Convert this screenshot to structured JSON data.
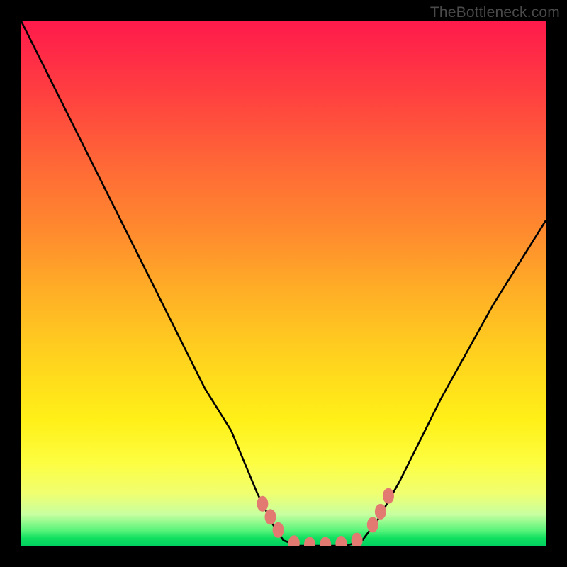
{
  "attribution": "TheBottleneck.com",
  "chart_data": {
    "type": "line",
    "title": "",
    "subtitle": "",
    "xlabel": "",
    "ylabel": "",
    "xlim": [
      0,
      100
    ],
    "ylim": [
      0,
      100
    ],
    "grid": false,
    "legend": false,
    "gradient_colors": {
      "top": "#ff1a4b",
      "upper_mid": "#ff8a2e",
      "mid": "#ffd21e",
      "lower_mid": "#fdfd40",
      "bottom": "#00d060"
    },
    "series": [
      {
        "name": "bottleneck-curve",
        "x": [
          0,
          5,
          10,
          15,
          20,
          25,
          30,
          35,
          40,
          45,
          48,
          50,
          53,
          56,
          59,
          62,
          65,
          68,
          72,
          76,
          80,
          85,
          90,
          95,
          100
        ],
        "y": [
          100,
          90,
          80,
          70,
          60,
          50,
          40,
          30,
          22,
          10,
          4,
          1,
          0,
          0,
          0,
          0,
          1,
          5,
          12,
          20,
          28,
          37,
          46,
          54,
          62
        ]
      }
    ],
    "markers": [
      {
        "name": "left-cluster-1",
        "x": 46,
        "y": 8
      },
      {
        "name": "left-cluster-2",
        "x": 47.5,
        "y": 5.5
      },
      {
        "name": "left-cluster-3",
        "x": 49,
        "y": 3
      },
      {
        "name": "bottom-1",
        "x": 52,
        "y": 0.5
      },
      {
        "name": "bottom-2",
        "x": 55,
        "y": 0.2
      },
      {
        "name": "bottom-3",
        "x": 58,
        "y": 0.2
      },
      {
        "name": "bottom-4",
        "x": 61,
        "y": 0.4
      },
      {
        "name": "bottom-5",
        "x": 64,
        "y": 1.0
      },
      {
        "name": "right-cluster-1",
        "x": 67,
        "y": 4
      },
      {
        "name": "right-cluster-2",
        "x": 68.5,
        "y": 6.5
      },
      {
        "name": "right-cluster-3",
        "x": 70,
        "y": 9.5
      }
    ],
    "marker_color": "#e37a72",
    "curve_color": "#000000"
  }
}
